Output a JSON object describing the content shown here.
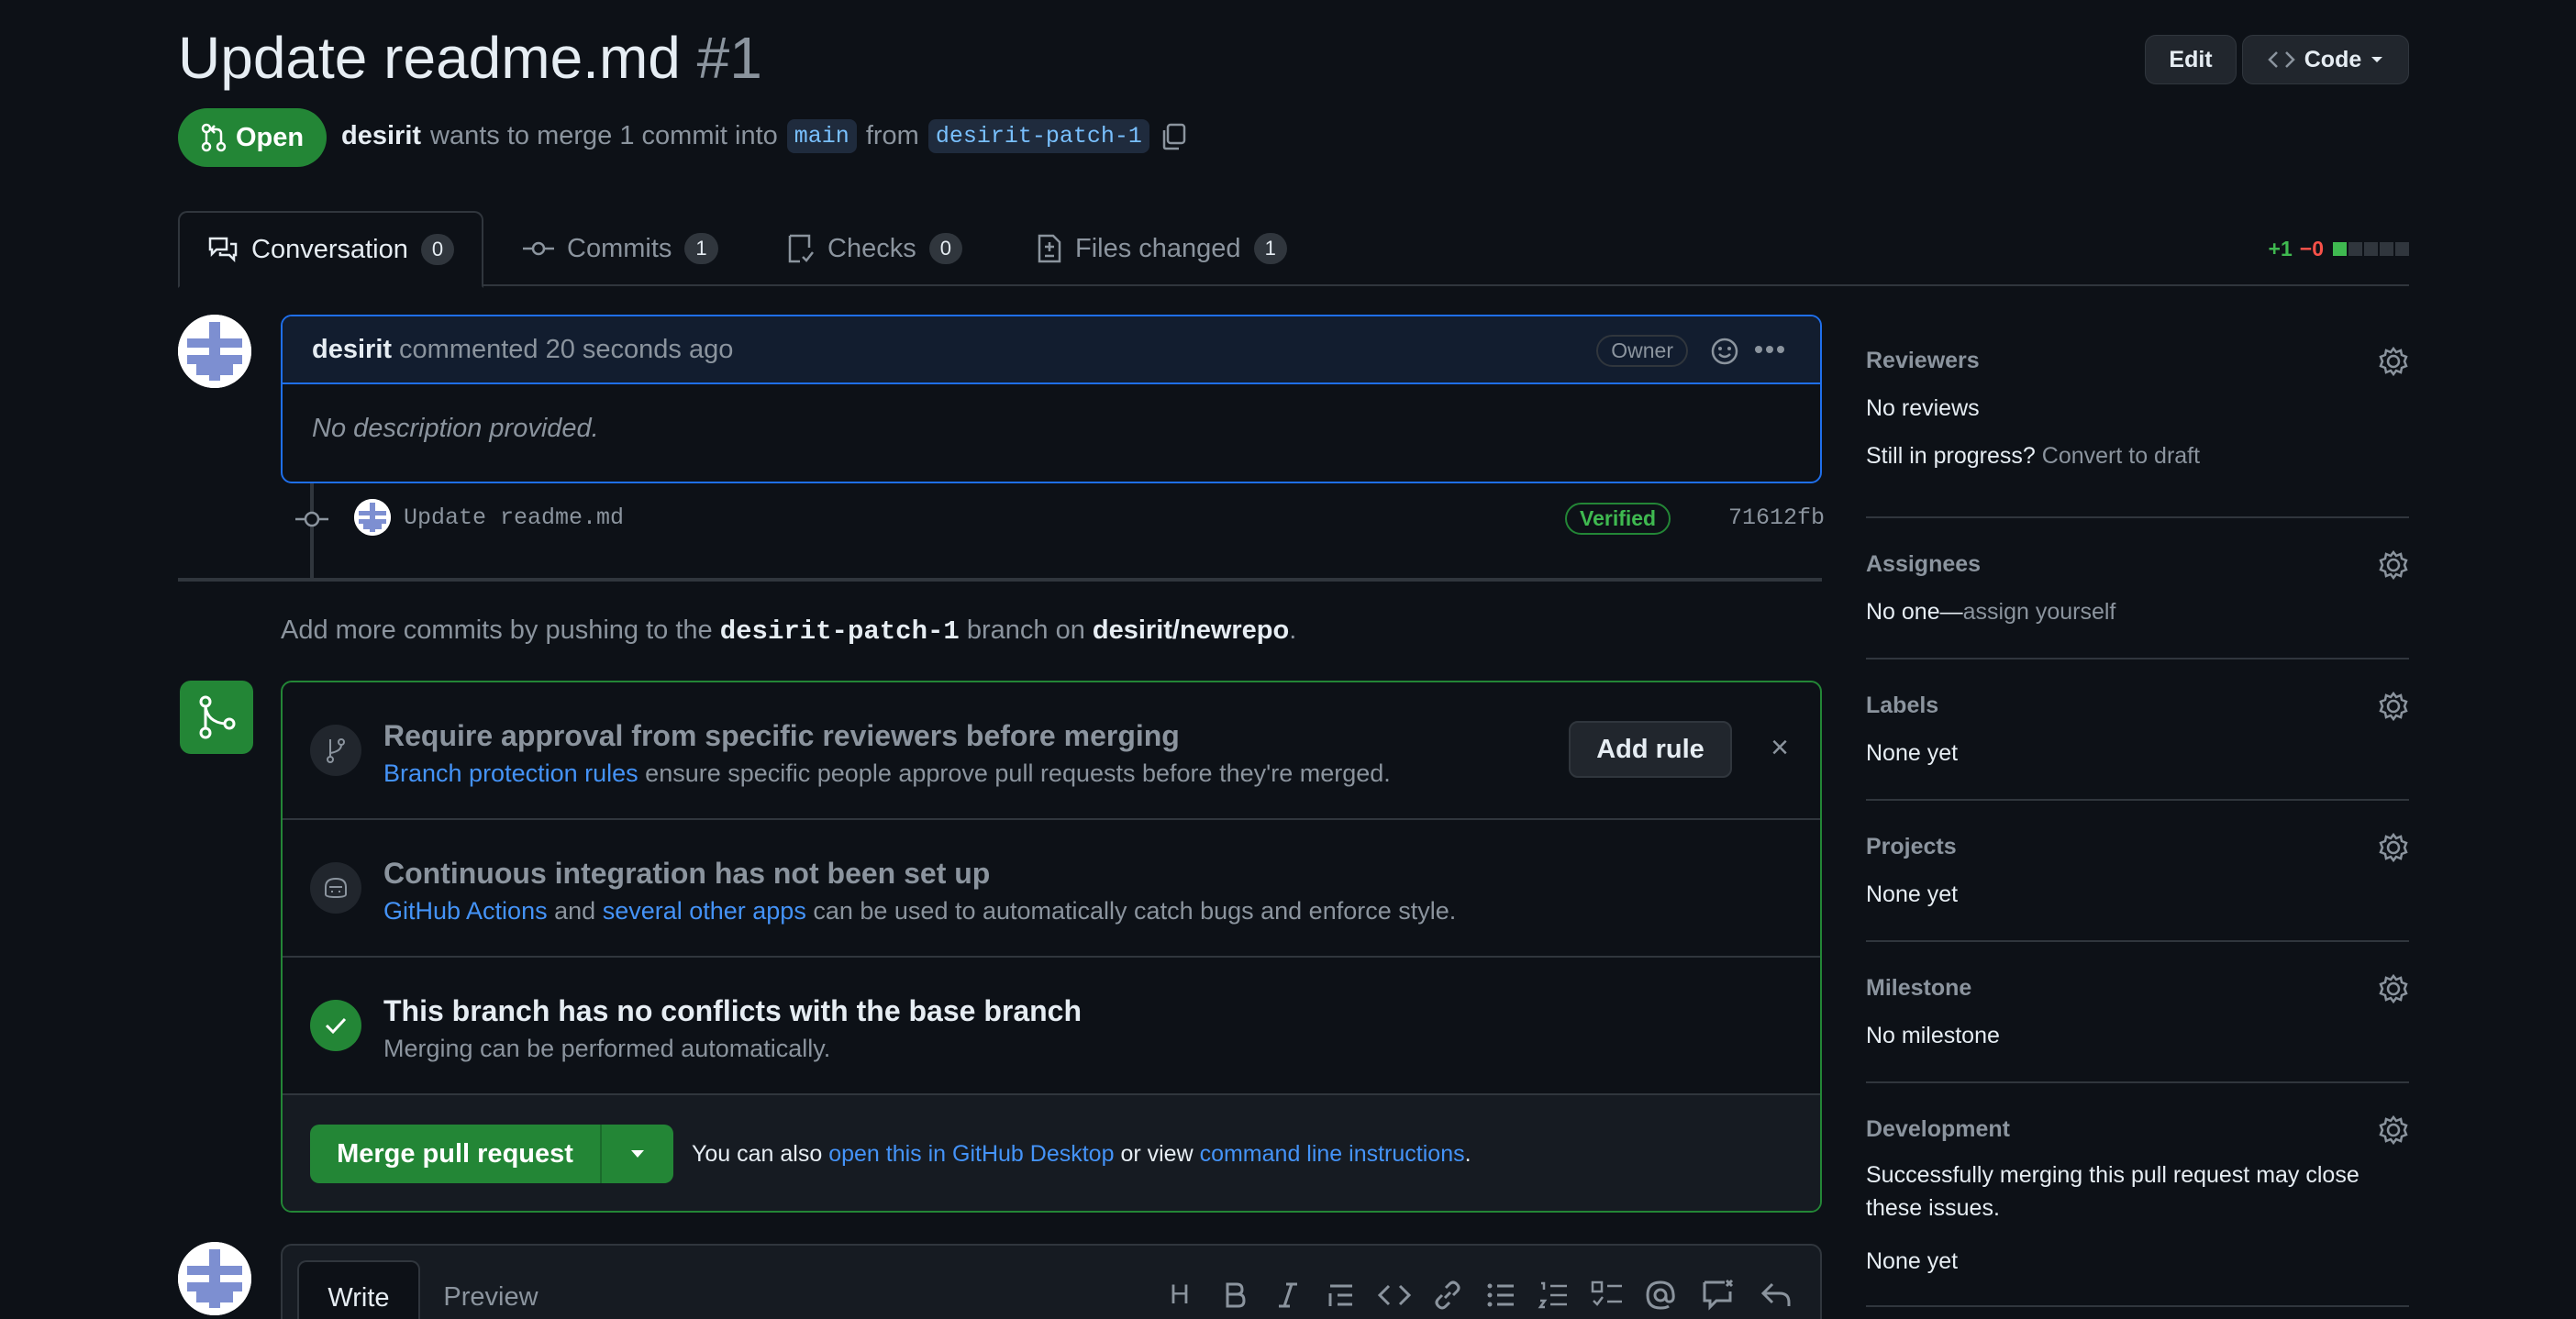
{
  "header": {
    "title": "Update readme.md",
    "number": "#1",
    "edit_label": "Edit",
    "code_label": "Code",
    "state_label": "Open",
    "author": "desirit",
    "merge_text": "wants to merge 1 commit into",
    "base_branch": "main",
    "from_text": "from",
    "head_branch": "desirit-patch-1"
  },
  "tabs": [
    {
      "label": "Conversation",
      "count": "0"
    },
    {
      "label": "Commits",
      "count": "1"
    },
    {
      "label": "Checks",
      "count": "0"
    },
    {
      "label": "Files changed",
      "count": "1"
    }
  ],
  "diffstat": {
    "additions": "+1",
    "deletions": "−0",
    "green_blocks": 1,
    "total_blocks": 5
  },
  "comment": {
    "author": "desirit",
    "action": "commented 20 seconds ago",
    "badge": "Owner",
    "body": "No description provided."
  },
  "commit": {
    "message": "Update readme.md",
    "verified": "Verified",
    "sha": "71612fb"
  },
  "push_hint": {
    "prefix": "Add more commits by pushing to the",
    "branch": "desirit-patch-1",
    "middle": "branch on",
    "repo": "desirit/newrepo",
    "suffix": "."
  },
  "mergebox": {
    "rules": {
      "heading": "Require approval from specific reviewers before merging",
      "link": "Branch protection rules",
      "text": "ensure specific people approve pull requests before they're merged.",
      "button": "Add rule",
      "close": "×"
    },
    "ci": {
      "heading": "Continuous integration has not been set up",
      "link1": "GitHub Actions",
      "and": "and",
      "link2": "several other apps",
      "text": "can be used to automatically catch bugs and enforce style."
    },
    "conflicts": {
      "heading": "This branch has no conflicts with the base branch",
      "text": "Merging can be performed automatically."
    },
    "merge": {
      "button": "Merge pull request",
      "also_prefix": "You can also",
      "desktop_link": "open this in GitHub Desktop",
      "or_view": "or view",
      "cli_link": "command line instructions",
      "period": "."
    }
  },
  "sidebar": {
    "reviewers": {
      "title": "Reviewers",
      "value": "No reviews",
      "progress_prefix": "Still in progress?",
      "draft_link": "Convert to draft"
    },
    "assignees": {
      "title": "Assignees",
      "value_prefix": "No one—",
      "assign_link": "assign yourself"
    },
    "labels": {
      "title": "Labels",
      "value": "None yet"
    },
    "projects": {
      "title": "Projects",
      "value": "None yet"
    },
    "milestone": {
      "title": "Milestone",
      "value": "No milestone"
    },
    "development": {
      "title": "Development",
      "text": "Successfully merging this pull request may close these issues.",
      "value": "None yet"
    }
  },
  "composer": {
    "write_tab": "Write",
    "preview_tab": "Preview",
    "heading_tool": "H"
  },
  "colors": {
    "accent_green": "#238636",
    "link_blue": "#4493f8",
    "bg": "#0d1117",
    "border": "#30363d"
  }
}
